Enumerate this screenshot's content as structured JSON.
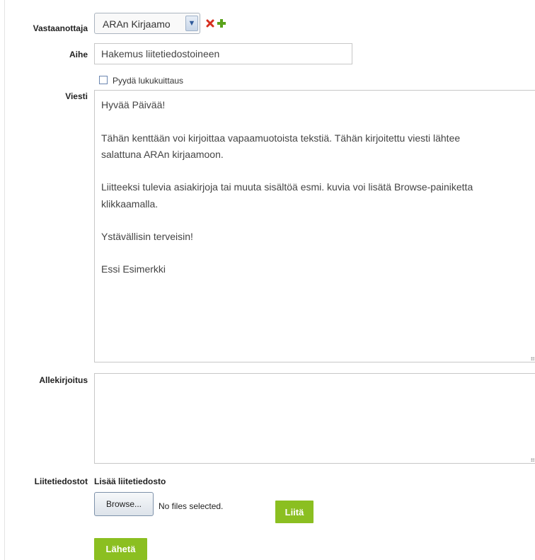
{
  "form": {
    "recipient": {
      "label": "Vastaanottaja",
      "selected": "ARAn Kirjaamo"
    },
    "subject": {
      "label": "Aihe",
      "value": "Hakemus liitetiedostoineen"
    },
    "read_receipt": {
      "label": "Pyydä lukukuittaus",
      "checked": false
    },
    "message": {
      "label": "Viesti",
      "lines": [
        "Hyvää Päivää!",
        "Tähän kenttään voi kirjoittaa vapaamuotoista tekstiä. Tähän kirjoitettu viesti lähtee",
        "salattuna ARAn kirjaamoon.",
        "Liitteeksi tulevia asiakirjoja tai muuta sisältöä esmi. kuvia voi lisätä Browse-painiketta",
        "klikkaamalla.",
        "Ystävällisin terveisin!",
        "Essi Esimerkki"
      ]
    },
    "signature": {
      "label": "Allekirjoitus",
      "value": ""
    },
    "attachments": {
      "label": "Liitetiedostot",
      "add_title": "Lisää liitetiedosto",
      "browse_label": "Browse...",
      "status": "No files selected.",
      "attach_label": "Liitä"
    },
    "send_label": "Lähetä"
  },
  "icons": {
    "remove": "remove-icon",
    "add": "add-icon"
  },
  "colors": {
    "accent_green": "#8bbf21",
    "remove_red": "#d62f1f",
    "add_green": "#5aa31b"
  }
}
